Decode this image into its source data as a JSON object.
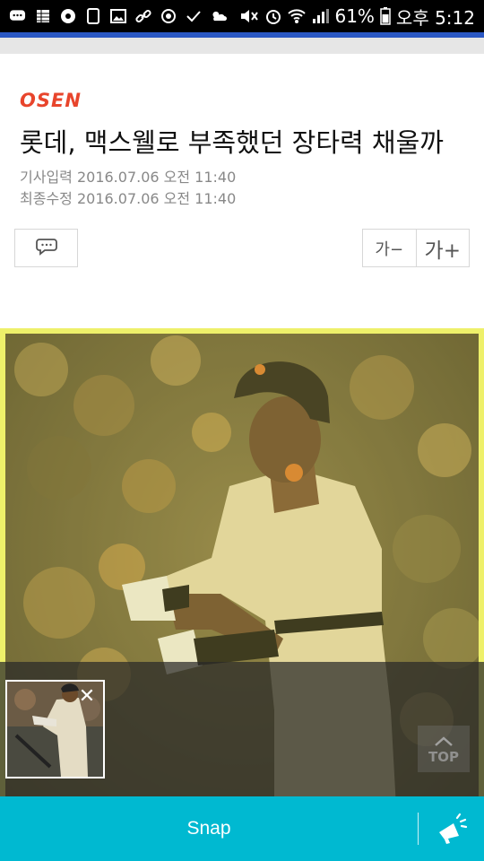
{
  "status_bar": {
    "battery": "61%",
    "time": "오후 5:12",
    "left_icons": [
      "chat-icon",
      "spreadsheet-icon",
      "settings-icon",
      "tablet-icon",
      "image-icon",
      "link-icon",
      "sync-icon",
      "check-icon",
      "weather-icon"
    ],
    "right_icons": [
      "mute-icon",
      "alarm-icon",
      "wifi-icon",
      "signal-icon",
      "battery-icon"
    ]
  },
  "article": {
    "source_logo": "OSEN",
    "title": "롯데, 맥스웰로 부족했던 장타력 채울까",
    "published": "기사입력 2016.07.06 오전 11:40",
    "modified": "최종수정 2016.07.06 오전 11:40"
  },
  "controls": {
    "font_decrease": "가−",
    "font_increase": "가+"
  },
  "overlay": {
    "top_label": "TOP",
    "close_glyph": "✕"
  },
  "snap_bar": {
    "label": "Snap"
  },
  "colors": {
    "accent": "#00b9d1",
    "logo": "#e8452c",
    "highlight_border": "#eef06a",
    "browser_line": "#2b58c4"
  }
}
